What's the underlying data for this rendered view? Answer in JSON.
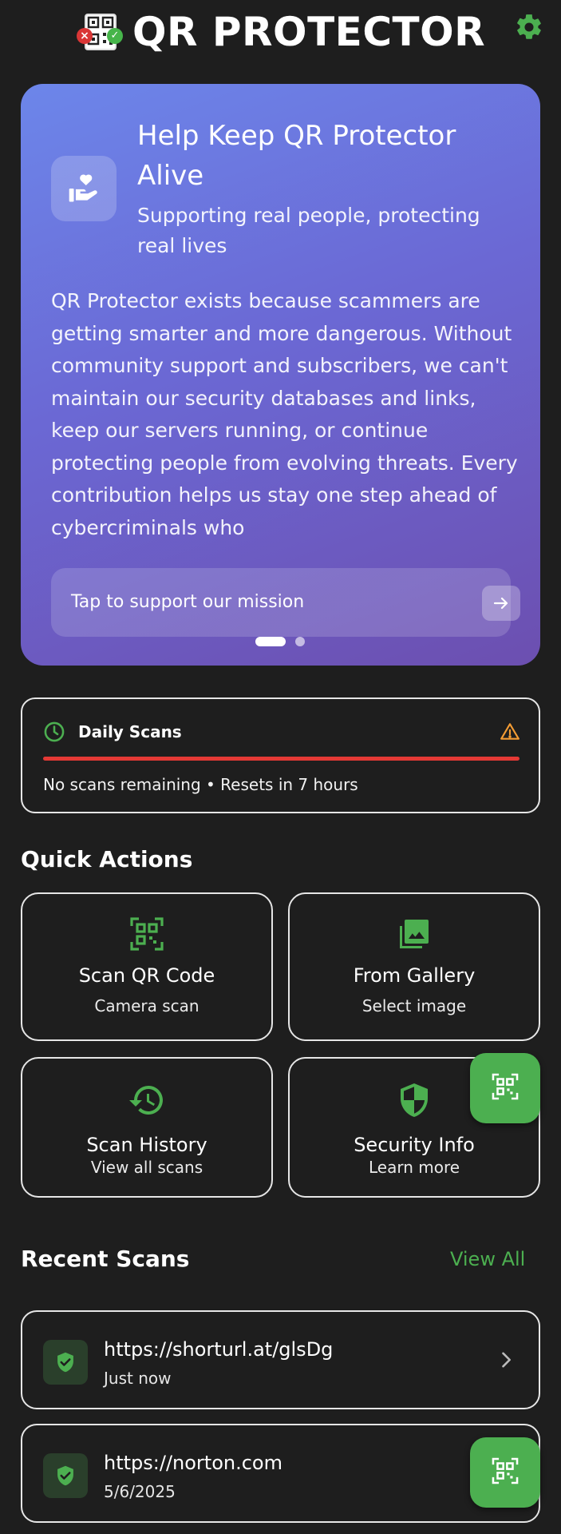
{
  "header": {
    "app_title": "QR PROTECTOR",
    "logo_icon": "qr-shield-logo-icon",
    "settings_icon": "gear-icon"
  },
  "hero": {
    "icon": "hand-heart-icon",
    "title": "Help Keep QR Protector Alive",
    "subtitle": "Supporting real people, protecting real lives",
    "body": "QR Protector exists because scammers are getting smarter and more dangerous. Without community support and subscribers, we can't maintain our security databases and links, keep our servers running, or continue protecting people from evolving threats. Every contribution helps us stay one step ahead of cybercriminals who",
    "cta_label": "Tap to support our mission",
    "cta_icon": "arrow-right-icon",
    "gradient_start": "#6c86ea",
    "gradient_end": "#6c4fb0"
  },
  "daily_scans": {
    "title": "Daily Scans",
    "status": "No scans remaining • Resets in 7 hours",
    "progress_used_fraction": 1.0,
    "bar_color": "#e53935",
    "warning_color": "#f39c34",
    "icon": "clock-icon"
  },
  "quick_actions": {
    "title": "Quick Actions",
    "items": [
      {
        "label": "Scan QR Code",
        "sub": "Camera scan",
        "icon": "qr-scan-icon"
      },
      {
        "label": "From Gallery",
        "sub": "Select image",
        "icon": "image-icon"
      },
      {
        "label": "Scan History",
        "sub": "View all scans",
        "icon": "history-icon"
      },
      {
        "label": "Security Info",
        "sub": "Learn more",
        "icon": "shield-icon"
      }
    ]
  },
  "recent_scans": {
    "title": "Recent Scans",
    "view_all": "View All",
    "items": [
      {
        "url": "https://shorturl.at/glsDg",
        "time": "Just now",
        "status_icon": "shield-check-icon"
      },
      {
        "url": "https://norton.com",
        "time": "5/6/2025",
        "status_icon": "shield-check-icon"
      }
    ]
  },
  "colors": {
    "accent": "#4caf50",
    "background": "#1e1e1e"
  },
  "fab_icon": "qr-scan-icon"
}
